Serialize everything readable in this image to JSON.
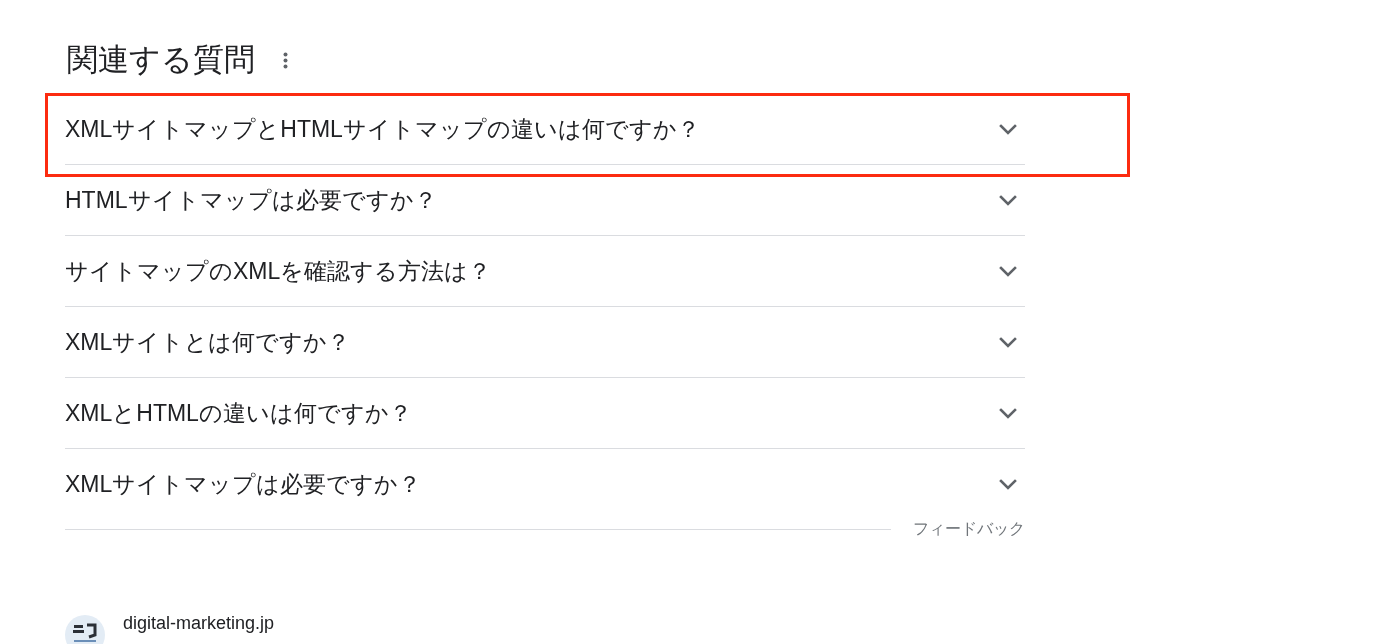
{
  "section": {
    "title": "関連する質問"
  },
  "questions": [
    {
      "text": "XMLサイトマップとHTMLサイトマップの違いは何ですか？",
      "expanded": false,
      "highlighted": true
    },
    {
      "text": "HTMLサイトマップは必要ですか？",
      "expanded": false,
      "highlighted": false
    },
    {
      "text": "サイトマップのXMLを確認する方法は？",
      "expanded": false,
      "highlighted": false
    },
    {
      "text": "XMLサイトとは何ですか？",
      "expanded": false,
      "highlighted": false
    },
    {
      "text": "XMLとHTMLの違いは何ですか？",
      "expanded": false,
      "highlighted": false
    },
    {
      "text": "XMLサイトマップは必要ですか？",
      "expanded": false,
      "highlighted": false
    }
  ],
  "feedback": {
    "label": "フィードバック"
  },
  "source": {
    "domain": "digital-marketing.jp"
  }
}
